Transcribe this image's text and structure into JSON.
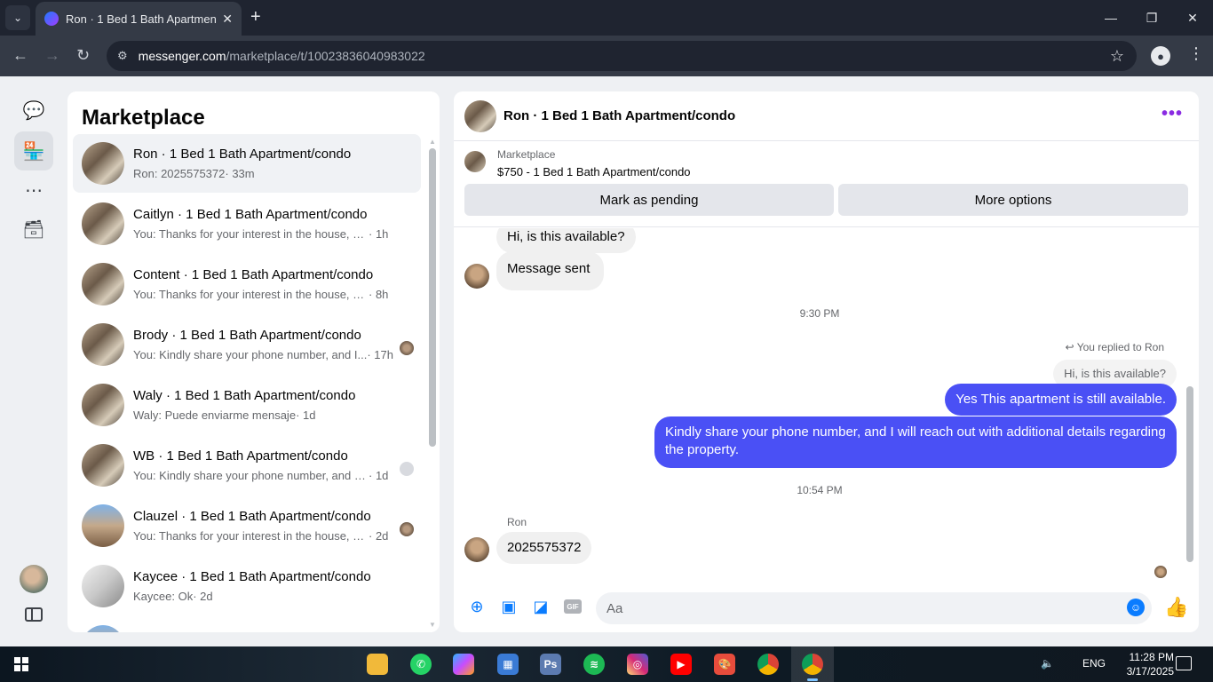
{
  "browser": {
    "tab_title": "Ron · 1 Bed 1 Bath Apartment/condo",
    "url_host": "messenger.com",
    "url_path": "/marketplace/t/10023836040983022"
  },
  "list": {
    "title": "Marketplace",
    "conversations": [
      {
        "name": "Ron · 1 Bed 1 Bath Apartment/condo",
        "snippet": "Ron: 2025575372",
        "time": "· 33m"
      },
      {
        "name": "Caitlyn · 1 Bed 1 Bath Apartment/condo",
        "snippet": "You: Thanks for your interest in the house, w...",
        "time": "· 1h"
      },
      {
        "name": "Content · 1 Bed 1 Bath Apartment/condo",
        "snippet": "You: Thanks for your interest in the house, w...",
        "time": "· 8h"
      },
      {
        "name": "Brody · 1 Bed 1 Bath Apartment/condo",
        "snippet": "You: Kindly share your phone number, and I...",
        "time": "· 17h"
      },
      {
        "name": "Waly · 1 Bed 1 Bath Apartment/condo",
        "snippet": "Waly: Puede enviarme mensaje",
        "time": "· 1d"
      },
      {
        "name": "WB · 1 Bed 1 Bath Apartment/condo",
        "snippet": "You: Kindly share your phone number, and I ...",
        "time": "· 1d"
      },
      {
        "name": "Clauzel · 1 Bed 1 Bath Apartment/condo",
        "snippet": "You: Thanks for your interest in the house, w...",
        "time": "· 2d"
      },
      {
        "name": "Kaycee · 1 Bed 1 Bath Apartment/condo",
        "snippet": "Kaycee: Ok",
        "time": "· 2d"
      }
    ]
  },
  "chat": {
    "header_title": "Ron · 1 Bed 1 Bath Apartment/condo",
    "listing_category": "Marketplace",
    "listing_price": "$750 - 1 Bed 1 Bath Apartment/condo",
    "mark_pending_label": "Mark as pending",
    "more_options_label": "More options",
    "messages": {
      "m1": "Hi, is this available?",
      "m2": "Message sent",
      "time1": "9:30 PM",
      "replied_label": "You replied to Ron",
      "quoted": "Hi, is this available?",
      "m3": "Yes This apartment is still available.",
      "m4": "Kindly share your phone number, and I will reach out with additional details regarding the property.",
      "time2": "10:54 PM",
      "sender": "Ron",
      "m5": "2025575372"
    },
    "composer_placeholder": "Aa"
  },
  "taskbar": {
    "lang": "ENG",
    "time": "11:28 PM",
    "date": "3/17/2025"
  }
}
